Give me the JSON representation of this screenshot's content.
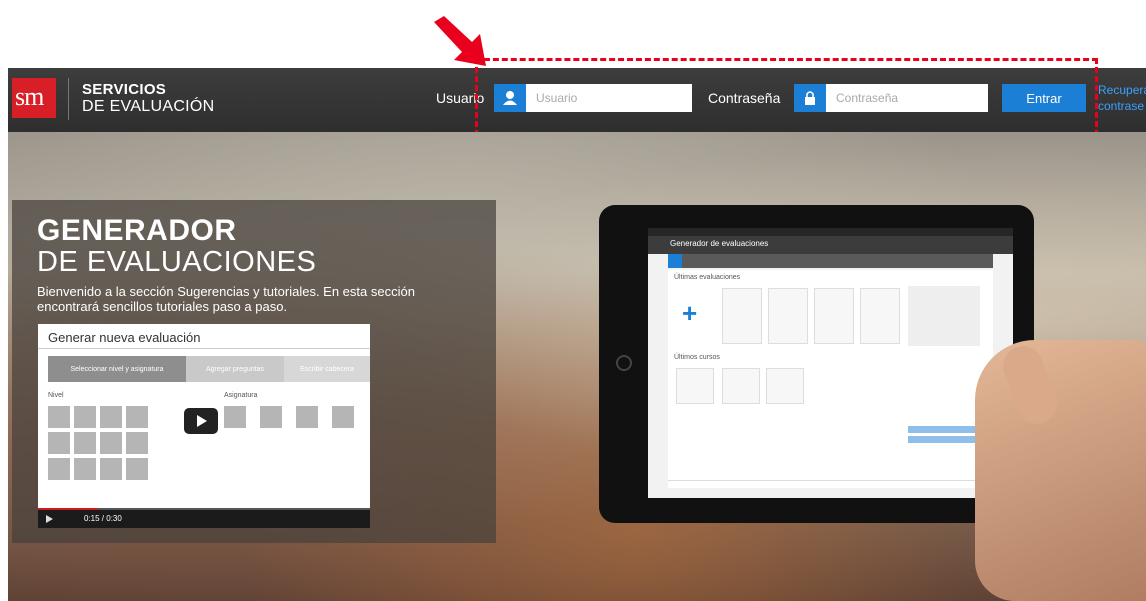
{
  "header": {
    "brand_logo": "sm",
    "brand_line1": "SERVICIOS",
    "brand_line2": "DE EVALUACIÓN",
    "user_label": "Usuario",
    "user_placeholder": "Usuario",
    "password_label": "Contraseña",
    "password_placeholder": "Contraseña",
    "enter_label": "Entrar",
    "recover_line1": "Recupera",
    "recover_line2": "contrase"
  },
  "hero": {
    "title_line1": "GENERADOR",
    "title_line2": "DE EVALUACIONES",
    "intro": "Bienvenido a la sección Sugerencias y tutoriales. En esta sección encontrará sencillos tutoriales paso a paso."
  },
  "video": {
    "title": "Generar nueva evaluación",
    "steps": [
      "Seleccionar nivel y asignatura",
      "Agregar preguntas",
      "Escribir cabecera"
    ],
    "level_label": "Nivel",
    "subject_label": "Asignatura",
    "time": "0:15 / 0:30",
    "progress": 0.18
  },
  "tablet": {
    "app_title": "Generador de evaluaciones",
    "section_recent": "Últimas evaluaciones",
    "section_courses": "Últimos cursos"
  },
  "icons": [
    "arrow-icon",
    "user-icon",
    "lock-icon",
    "play-icon",
    "plus-icon"
  ],
  "colors": {
    "accent": "#1c7fd6",
    "brand": "#d81f27",
    "annotation": "#e8001c"
  }
}
